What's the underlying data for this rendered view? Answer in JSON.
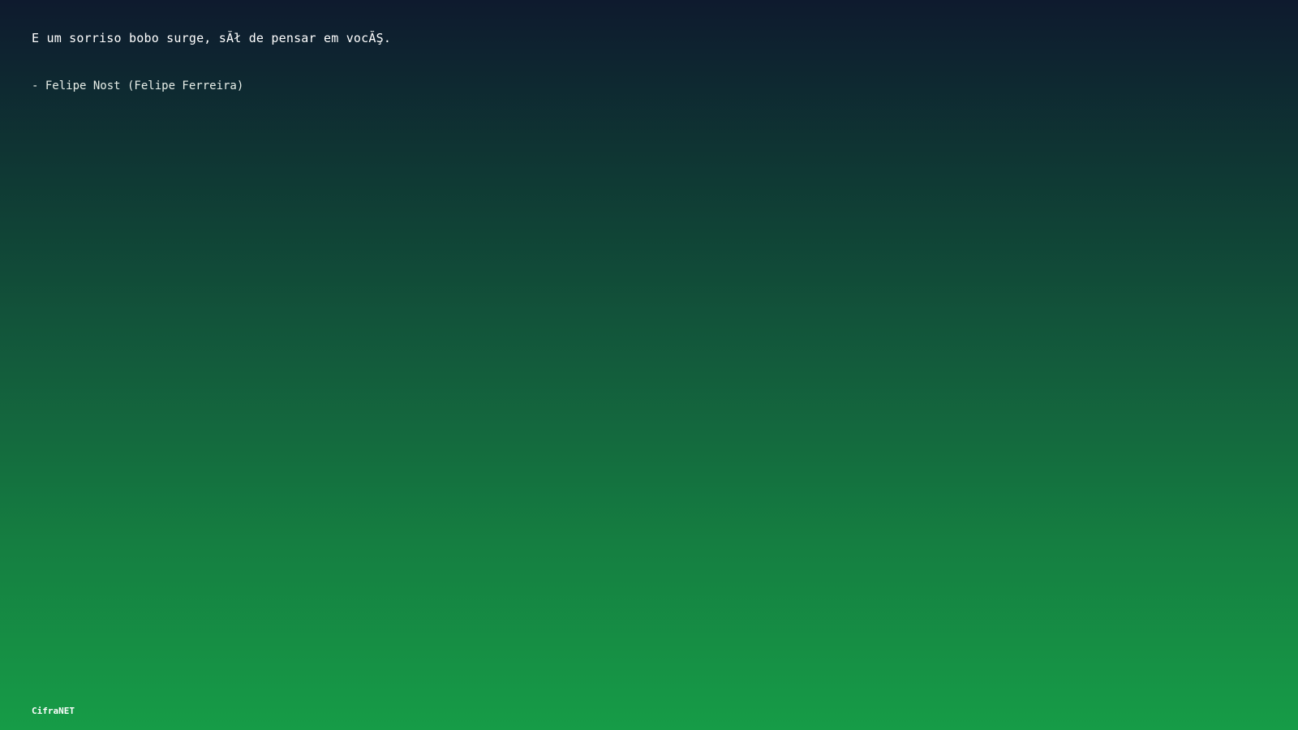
{
  "quote": {
    "text": "E um sorriso bobo surge, sĂł de pensar em vocĂŞ.",
    "author": "- Felipe Nost (Felipe Ferreira)"
  },
  "footer": {
    "brand": "CifraNET"
  },
  "theme": {
    "gradient_top": "#0e1a2e",
    "gradient_bottom": "#169c47",
    "text_color": "#ffffff"
  }
}
